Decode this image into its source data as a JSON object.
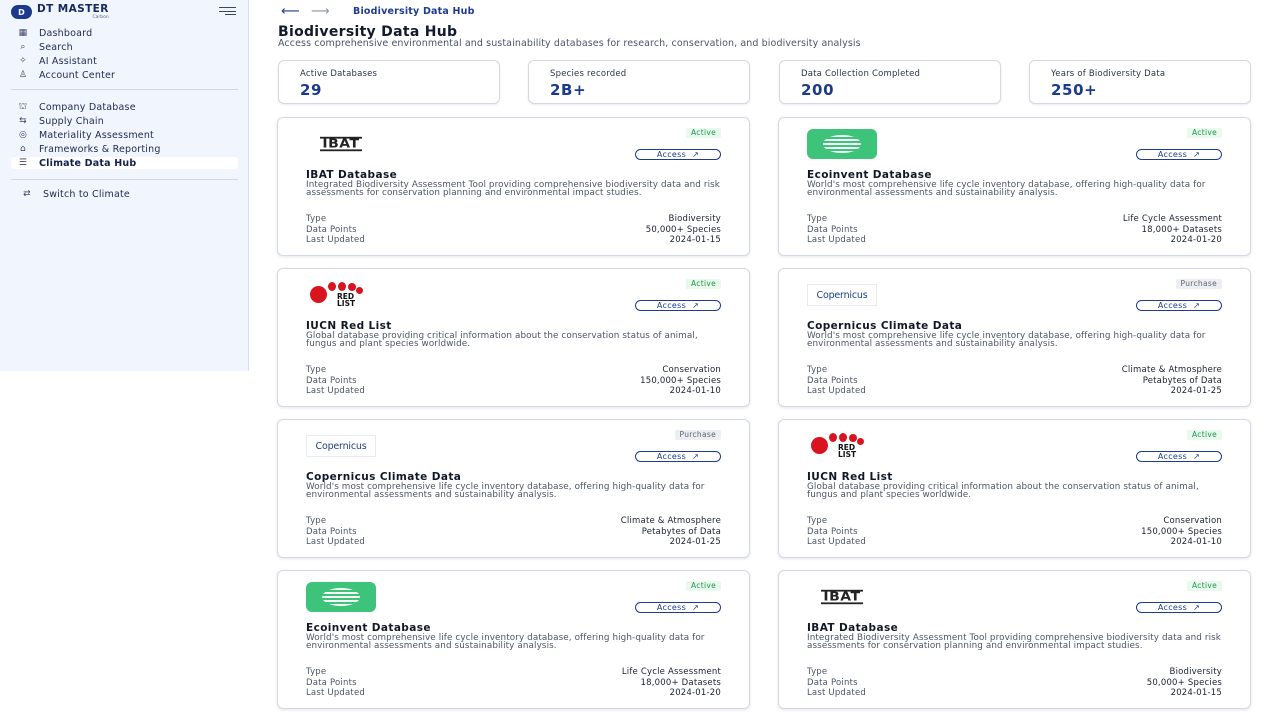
{
  "brand": {
    "name": "DT MASTER",
    "sub": "Carbon",
    "logo_text": "D"
  },
  "sidebar": {
    "items": [
      {
        "label": "Dashboard",
        "icon": "dashboard-icon",
        "glyph": "▦"
      },
      {
        "label": "Search",
        "icon": "search-icon",
        "glyph": "⌕"
      },
      {
        "label": "AI Assistant",
        "icon": "sparkle-icon",
        "glyph": "✧"
      },
      {
        "label": "Account Center",
        "icon": "user-icon",
        "glyph": "♙"
      },
      {
        "label": "Company Database",
        "icon": "company-icon",
        "glyph": "⛫"
      },
      {
        "label": "Supply Chain",
        "icon": "supply-chain-icon",
        "glyph": "⇆"
      },
      {
        "label": "Materiality Assessment",
        "icon": "assessment-icon",
        "glyph": "◎"
      },
      {
        "label": "Frameworks & Reporting",
        "icon": "bank-icon",
        "glyph": "⌂"
      },
      {
        "label": "Climate Data Hub",
        "icon": "database-icon",
        "glyph": "☰"
      }
    ],
    "switch_label": "Switch to Climate",
    "switch_icon": "switch-icon",
    "switch_glyph": "⇄"
  },
  "header": {
    "breadcrumb": "Biodiversity Data Hub",
    "title": "Biodiversity Data Hub",
    "subtitle": "Access comprehensive environmental and sustainability databases for research, conservation, and biodiversity analysis"
  },
  "stats": [
    {
      "label": "Active Databases",
      "value": "29"
    },
    {
      "label": "Species recorded",
      "value": "2B+"
    },
    {
      "label": "Data Collection Completed",
      "value": "200"
    },
    {
      "label": "Years of Biodiversity Data",
      "value": "250+"
    }
  ],
  "meta_labels": {
    "type": "Type",
    "points": "Data Points",
    "updated": "Last Updated"
  },
  "access_label": "Access",
  "cards": [
    {
      "logo": "IBAT",
      "status": "Active",
      "title": "IBAT Database",
      "desc": "Integrated Biodiversity Assessment Tool providing comprehensive biodiversity data and risk assessments for conservation planning and environmental impact studies.",
      "type": "Biodiversity",
      "points": "50,000+ Species",
      "updated": "2024-01-15"
    },
    {
      "logo": "ecoinvent",
      "status": "Active",
      "title": "Ecoinvent Database",
      "desc": "World's most comprehensive life cycle inventory database, offering high-quality data for environmental assessments and sustainability analysis.",
      "type": "Life Cycle Assessment",
      "points": "18,000+ Datasets",
      "updated": "2024-01-20"
    },
    {
      "logo": "iucn",
      "status": "Active",
      "title": "IUCN Red List",
      "desc": "Global database providing critical information about the conservation status of animal, fungus and plant species worldwide.",
      "type": "Conservation",
      "points": "150,000+ Species",
      "updated": "2024-01-10"
    },
    {
      "logo": "copernicus",
      "status": "Purchase",
      "title": "Copernicus Climate Data",
      "desc": "World's most comprehensive life cycle inventory database, offering high-quality data for environmental assessments and sustainability analysis.",
      "type": "Climate & Atmosphere",
      "points": "Petabytes of Data",
      "updated": "2024-01-25"
    },
    {
      "logo": "copernicus",
      "status": "Purchase",
      "title": "Copernicus Climate Data",
      "desc": "World's most comprehensive life cycle inventory database, offering high-quality data for environmental assessments and sustainability analysis.",
      "type": "Climate & Atmosphere",
      "points": "Petabytes of Data",
      "updated": "2024-01-25"
    },
    {
      "logo": "iucn",
      "status": "Active",
      "title": "IUCN Red List",
      "desc": "Global database providing critical information about the conservation status of animal, fungus and plant species worldwide.",
      "type": "Conservation",
      "points": "150,000+ Species",
      "updated": "2024-01-10"
    },
    {
      "logo": "ecoinvent",
      "status": "Active",
      "title": "Ecoinvent Database",
      "desc": "World's most comprehensive life cycle inventory database, offering high-quality data for environmental assessments and sustainability analysis.",
      "type": "Life Cycle Assessment",
      "points": "18,000+ Datasets",
      "updated": "2024-01-20"
    },
    {
      "logo": "IBAT",
      "status": "Active",
      "title": "IBAT Database",
      "desc": "Integrated Biodiversity Assessment Tool providing comprehensive biodiversity data and risk assessments for conservation planning and environmental impact studies.",
      "type": "Biodiversity",
      "points": "50,000+ Species",
      "updated": "2024-01-15"
    }
  ],
  "logo_text": {
    "ibat": "IBAT",
    "iucn_line1": "RED",
    "iucn_line2": "LIST",
    "copernicus": "Copernicus"
  },
  "colors": {
    "accent": "#1b3a8c",
    "active_badge": "#1b9a4a",
    "ecoinvent_green": "#3ec47a",
    "iucn_red": "#d9141f"
  }
}
